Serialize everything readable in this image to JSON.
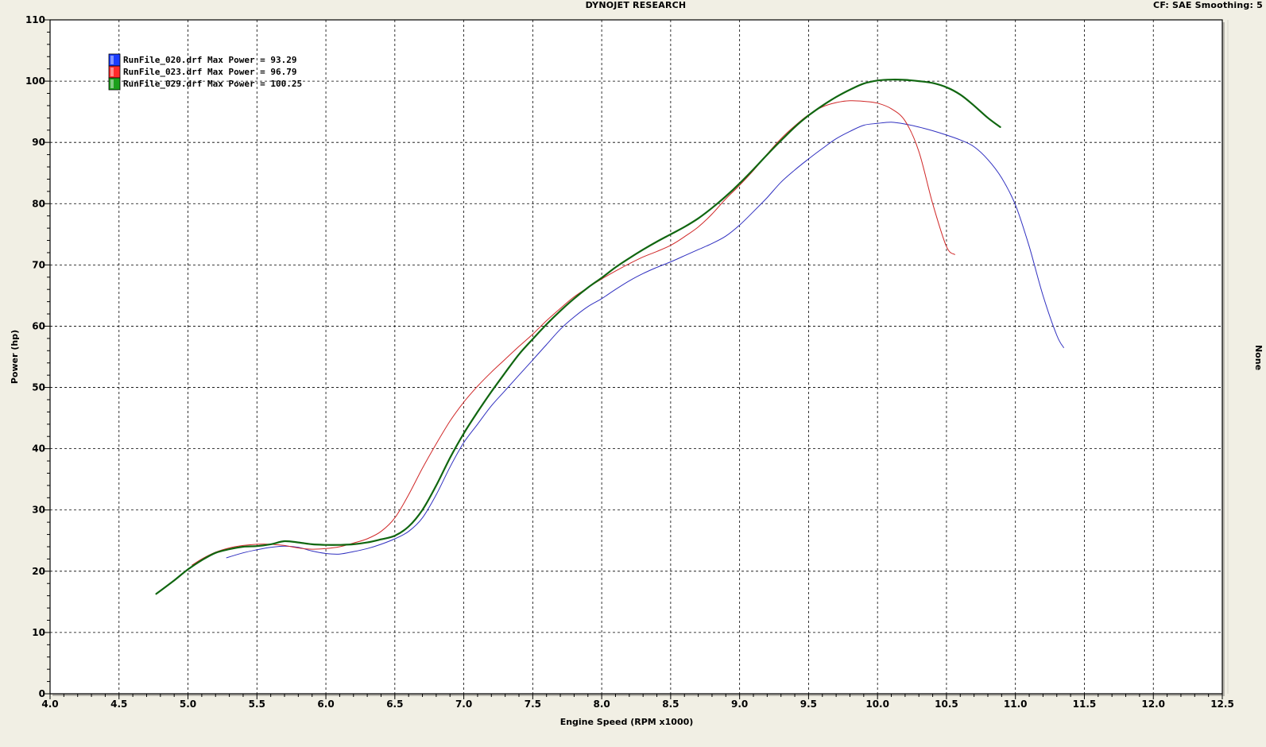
{
  "header": {
    "title": "DYNOJET RESEARCH",
    "settings": "CF: SAE  Smoothing: 5"
  },
  "right_panel_label": "None",
  "chart_data": {
    "type": "line",
    "title": "DYNOJET RESEARCH",
    "xlabel": "Engine Speed (RPM x1000)",
    "ylabel": "Power (hp)",
    "xlim": [
      4.0,
      12.5
    ],
    "ylim": [
      0,
      110
    ],
    "x_ticks": [
      4.0,
      4.5,
      5.0,
      5.5,
      6.0,
      6.5,
      7.0,
      7.5,
      8.0,
      8.5,
      9.0,
      9.5,
      10.0,
      10.5,
      11.0,
      11.5,
      12.0,
      12.5
    ],
    "x_tick_labels": [
      "4.0",
      "4.5",
      "5.0",
      "5.5",
      "6.0",
      "6.5",
      "7.0",
      "7.5",
      "8.0",
      "8.5",
      "9.0",
      "9.5",
      "10.0",
      "10.5",
      "11.0",
      "11.5",
      "12.0",
      "12.5"
    ],
    "y_ticks": [
      0,
      10,
      20,
      30,
      40,
      50,
      60,
      70,
      80,
      90,
      100,
      110
    ],
    "y_tick_labels": [
      "0",
      "10",
      "20",
      "30",
      "40",
      "50",
      "60",
      "70",
      "80",
      "90",
      "100",
      "110"
    ],
    "grid": true,
    "legend_position": "top-left",
    "series": [
      {
        "name": "RunFile_020.drf Max Power = 93.29",
        "color": "#3030c0",
        "swatch": "#1a3cff",
        "width": 1,
        "x": [
          5.28,
          5.4,
          5.5,
          5.6,
          5.7,
          5.8,
          5.9,
          6.0,
          6.1,
          6.2,
          6.3,
          6.4,
          6.5,
          6.6,
          6.7,
          6.8,
          6.9,
          7.0,
          7.1,
          7.2,
          7.3,
          7.4,
          7.5,
          7.6,
          7.7,
          7.8,
          7.9,
          8.0,
          8.1,
          8.2,
          8.3,
          8.4,
          8.5,
          8.6,
          8.7,
          8.8,
          8.9,
          9.0,
          9.1,
          9.2,
          9.3,
          9.4,
          9.5,
          9.6,
          9.7,
          9.8,
          9.9,
          10.0,
          10.1,
          10.2,
          10.3,
          10.4,
          10.5,
          10.6,
          10.7,
          10.8,
          10.9,
          11.0,
          11.1,
          11.2,
          11.3,
          11.35
        ],
        "y": [
          22.2,
          23.0,
          23.5,
          23.9,
          24.1,
          23.9,
          23.3,
          22.9,
          22.8,
          23.2,
          23.7,
          24.4,
          25.3,
          26.5,
          28.7,
          32.5,
          37.0,
          41.0,
          44.0,
          47.0,
          49.5,
          52.0,
          54.5,
          57.0,
          59.5,
          61.5,
          63.2,
          64.5,
          66.0,
          67.4,
          68.6,
          69.6,
          70.5,
          71.5,
          72.5,
          73.5,
          74.7,
          76.5,
          78.7,
          81.0,
          83.5,
          85.5,
          87.3,
          89.0,
          90.6,
          91.8,
          92.8,
          93.1,
          93.3,
          93.0,
          92.5,
          91.9,
          91.2,
          90.4,
          89.3,
          87.2,
          84.2,
          79.8,
          73.0,
          65.0,
          58.5,
          56.5
        ]
      },
      {
        "name": "RunFile_023.drf Max Power = 96.79",
        "color": "#d02828",
        "swatch": "#ff2a2a",
        "width": 1,
        "x": [
          5.03,
          5.1,
          5.2,
          5.3,
          5.4,
          5.5,
          5.6,
          5.7,
          5.8,
          5.9,
          6.0,
          6.1,
          6.2,
          6.3,
          6.4,
          6.5,
          6.6,
          6.7,
          6.8,
          6.9,
          7.0,
          7.1,
          7.2,
          7.3,
          7.4,
          7.5,
          7.6,
          7.7,
          7.8,
          7.9,
          8.0,
          8.1,
          8.2,
          8.3,
          8.4,
          8.5,
          8.6,
          8.7,
          8.8,
          8.9,
          9.0,
          9.1,
          9.2,
          9.3,
          9.4,
          9.5,
          9.6,
          9.7,
          9.8,
          9.9,
          10.0,
          10.1,
          10.2,
          10.3,
          10.4,
          10.5,
          10.56
        ],
        "y": [
          21.0,
          22.0,
          23.1,
          23.8,
          24.2,
          24.4,
          24.4,
          24.2,
          23.8,
          23.6,
          23.7,
          24.0,
          24.6,
          25.3,
          26.5,
          28.7,
          32.5,
          36.8,
          40.8,
          44.5,
          47.6,
          50.2,
          52.5,
          54.6,
          56.7,
          58.7,
          60.9,
          62.9,
          64.8,
          66.3,
          67.7,
          69.0,
          70.2,
          71.3,
          72.2,
          73.2,
          74.6,
          76.2,
          78.3,
          80.8,
          83.0,
          85.4,
          88.1,
          90.6,
          92.7,
          94.5,
          95.8,
          96.5,
          96.8,
          96.7,
          96.4,
          95.5,
          93.5,
          88.5,
          80.0,
          73.0,
          71.7
        ]
      },
      {
        "name": "RunFile_029.drf Max Power = 100.25",
        "color": "#106610",
        "swatch": "#1ca01c",
        "width": 2.2,
        "x": [
          4.77,
          4.9,
          5.0,
          5.1,
          5.2,
          5.3,
          5.4,
          5.5,
          5.6,
          5.7,
          5.8,
          5.9,
          6.0,
          6.1,
          6.2,
          6.3,
          6.4,
          6.5,
          6.6,
          6.7,
          6.8,
          6.9,
          7.0,
          7.1,
          7.2,
          7.3,
          7.4,
          7.5,
          7.6,
          7.7,
          7.8,
          7.9,
          8.0,
          8.1,
          8.2,
          8.3,
          8.4,
          8.5,
          8.6,
          8.7,
          8.8,
          8.9,
          9.0,
          9.1,
          9.2,
          9.3,
          9.4,
          9.5,
          9.6,
          9.7,
          9.8,
          9.9,
          10.0,
          10.1,
          10.2,
          10.3,
          10.4,
          10.5,
          10.6,
          10.7,
          10.8,
          10.89
        ],
        "y": [
          16.3,
          18.5,
          20.3,
          21.8,
          23.0,
          23.6,
          24.0,
          24.1,
          24.4,
          24.9,
          24.7,
          24.4,
          24.3,
          24.3,
          24.4,
          24.7,
          25.2,
          25.8,
          27.3,
          30.0,
          34.0,
          38.5,
          42.5,
          46.0,
          49.3,
          52.4,
          55.4,
          57.9,
          60.3,
          62.5,
          64.5,
          66.3,
          67.9,
          69.6,
          71.1,
          72.5,
          73.8,
          75.0,
          76.2,
          77.6,
          79.3,
          81.2,
          83.3,
          85.6,
          88.0,
          90.3,
          92.5,
          94.4,
          96.0,
          97.4,
          98.6,
          99.6,
          100.1,
          100.25,
          100.2,
          100.0,
          99.7,
          99.0,
          97.8,
          96.0,
          94.0,
          92.5
        ]
      }
    ]
  }
}
